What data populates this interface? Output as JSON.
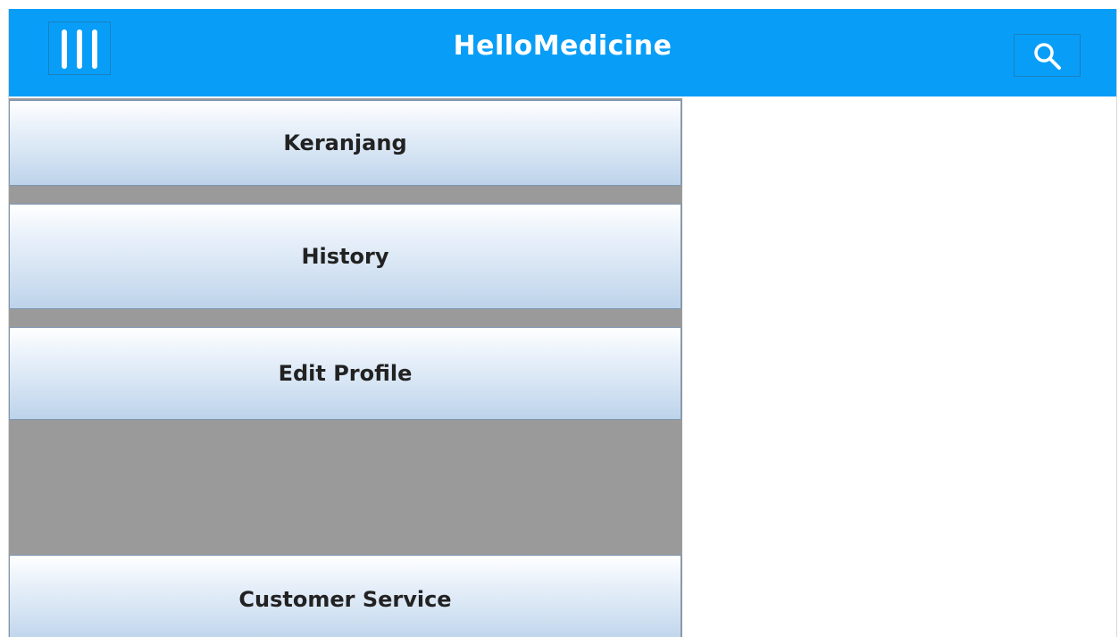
{
  "appbar": {
    "title": "HelloMedicine",
    "background_color": "#089ef7",
    "menu_icon": "hamburger-menu-icon",
    "search_icon": "search-icon"
  },
  "sidebar": {
    "items": [
      {
        "label": "Keranjang"
      },
      {
        "label": "History"
      },
      {
        "label": "Edit Profile"
      },
      {
        "label": "Customer Service"
      }
    ]
  }
}
